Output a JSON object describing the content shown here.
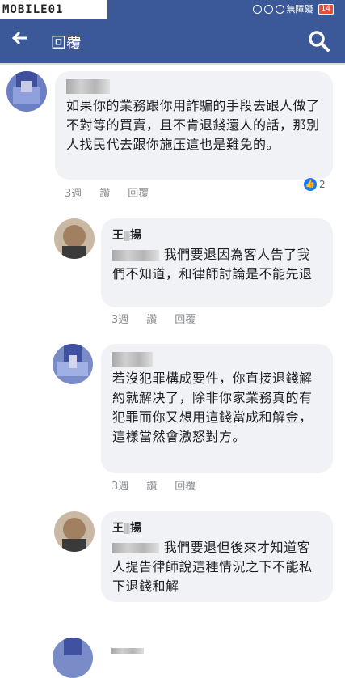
{
  "status_bar": {
    "watermark": "MOBILE01",
    "network": "無障礙",
    "battery": "14"
  },
  "app_bar": {
    "title": "回覆"
  },
  "comments": [
    {
      "name": "",
      "text": "如果你的業務跟你用詐騙的手段去跟人做了不對等的買賣，且不肯退錢還人的話，那別人找民代去跟你施压這也是難免的。",
      "time": "3週",
      "like": "讚",
      "reply": "回覆",
      "reactions": "2"
    },
    {
      "name": "王",
      "name2": "揚",
      "text": "我們要退因為客人告了我們不知道，和律師討論是不能先退",
      "time": "3週",
      "like": "讚",
      "reply": "回覆"
    },
    {
      "name": "",
      "text": "若沒犯罪構成要件，你直接退錢解約就解决了，除非你家業務真的有犯罪而你又想用這錢當成和解金，這樣當然會激怒對方。",
      "time": "3週",
      "like": "讚",
      "reply": "回覆"
    },
    {
      "name": "王",
      "name2": "揚",
      "text": "我們要退但後來才知道客人提告律師說這種情況之下不能私下退錢和解"
    }
  ]
}
